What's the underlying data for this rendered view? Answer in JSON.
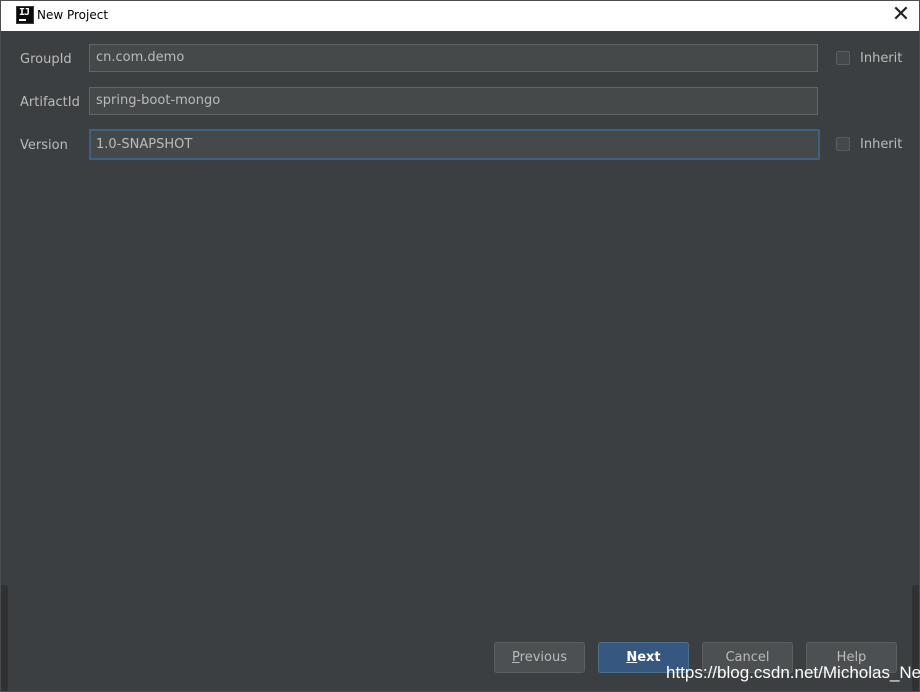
{
  "window": {
    "title": "New Project",
    "close_glyph": "✕",
    "icon": "intellij-idea-icon",
    "icon_text": "IJ"
  },
  "form": {
    "group_id": {
      "label": "GroupId",
      "value": "cn.com.demo",
      "inherit_label": "Inherit",
      "inherit_checked": false
    },
    "artifact_id": {
      "label": "ArtifactId",
      "value": "spring-boot-mongo"
    },
    "version": {
      "label": "Version",
      "value": "1.0-SNAPSHOT",
      "inherit_label": "Inherit",
      "inherit_checked": false
    }
  },
  "buttons": {
    "previous": {
      "mnemonic": "P",
      "rest": "revious"
    },
    "next": {
      "mnemonic": "N",
      "rest": "ext"
    },
    "cancel": "Cancel",
    "help": "Help"
  },
  "watermark": "https://blog.csdn.net/Micholas_Net",
  "colors": {
    "background": "#3c3f41",
    "field_background": "#45494a",
    "focus_border": "#3d6185",
    "primary_button": "#365880",
    "text": "#bbbbbb"
  }
}
